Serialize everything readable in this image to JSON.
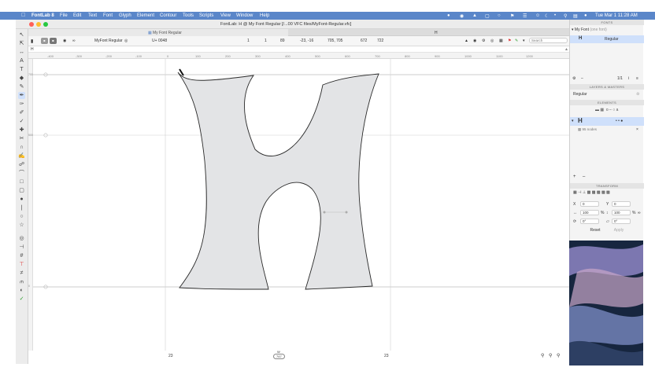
{
  "menubar": {
    "apple_icon": "apple-logo",
    "app_name": "FontLab 8",
    "items": [
      "File",
      "Edit",
      "Text",
      "Font",
      "Glyph",
      "Element",
      "Contour",
      "Tools",
      "Scripts",
      "View",
      "Window",
      "Help"
    ],
    "clock": "Tue Mar 1 11:28 AM"
  },
  "window": {
    "title": "FontLab: H @ My Font Regular [/...00 VFC files/MyFont-Regular.vfc]",
    "tab_label": "My Font Regular",
    "tab_right": "H"
  },
  "toolbar": {
    "font_select": "MyFont Regular",
    "glyph_code": "0048",
    "metric_a": "1",
    "metric_b": "1",
    "metric_c": "89",
    "coords": "-23, -16",
    "size": "705, 705",
    "val_d": "672",
    "val_e": "722",
    "search_placeholder": "Search"
  },
  "text_row": {
    "text": "H"
  },
  "ruler": {
    "ticks": [
      "-400",
      "-300",
      "-200",
      "-100",
      "0",
      "100",
      "200",
      "300",
      "400",
      "500",
      "600",
      "700",
      "800",
      "900",
      "1000",
      "1100",
      "1200"
    ]
  },
  "vruler": {
    "labels": [
      "700",
      "500",
      "0"
    ]
  },
  "canvas": {
    "left_sidebearing": "23",
    "right_sidebearing": "23",
    "advance_width": "747",
    "width_label": "W",
    "mid_label": "-186"
  },
  "panel": {
    "fonts_header": "FONTS",
    "font_name": "My Font",
    "font_note": "(one font)",
    "glyph_name": "Regular",
    "layers_header": "LAYERS & MASTERS",
    "layer_name": "Regular",
    "elements_header": "ELEMENTS",
    "element_nodes": "95 nodes",
    "transform_header": "TRANSFORM",
    "x_val": "0",
    "y_val": "0",
    "scale_x": "100",
    "scale_y": "100",
    "rotate": "0°",
    "slant": "0°",
    "pct": "%",
    "reset_label": "Reset",
    "apply_label": "Apply",
    "counter": "1/1"
  },
  "colors": {
    "menubar": "#5a86c9",
    "glyph_fill": "#e3e4e6",
    "selection": "#cfe0fb"
  }
}
